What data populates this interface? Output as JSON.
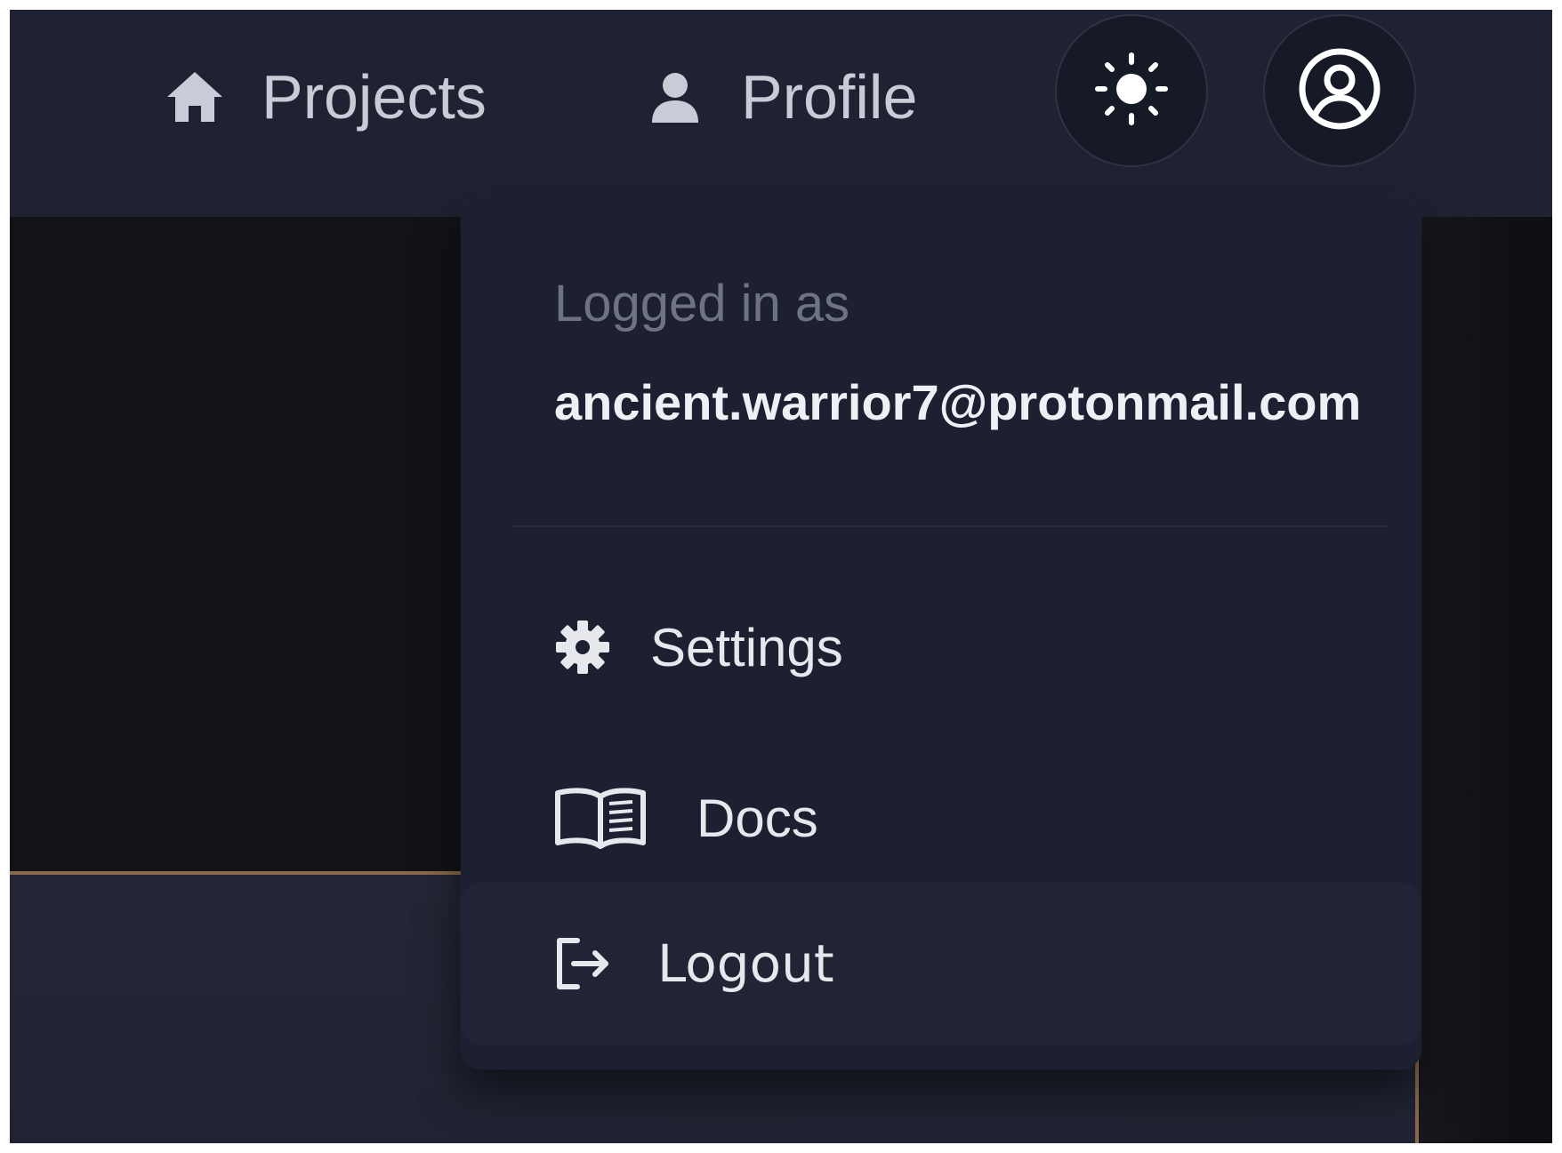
{
  "nav": {
    "projects_label": "Projects",
    "projects_icon": "home-icon",
    "profile_label": "Profile",
    "profile_icon": "user-icon",
    "theme_toggle_icon": "sun-icon",
    "account_icon": "user-circle-icon"
  },
  "account_menu": {
    "logged_in_label": "Logged in as",
    "email": "ancient.warrior7@protonmail.com",
    "items": [
      {
        "label": "Settings",
        "icon": "gear-icon"
      },
      {
        "label": "Docs",
        "icon": "book-open-icon"
      },
      {
        "label": "Logout",
        "icon": "logout-icon"
      }
    ]
  },
  "colors": {
    "navbar_bg": "#1f2232",
    "menu_bg": "#1d2030",
    "menu_text": "#e6e8ee",
    "muted_text": "#6e7384",
    "accent_border": "#8a6a4c"
  }
}
